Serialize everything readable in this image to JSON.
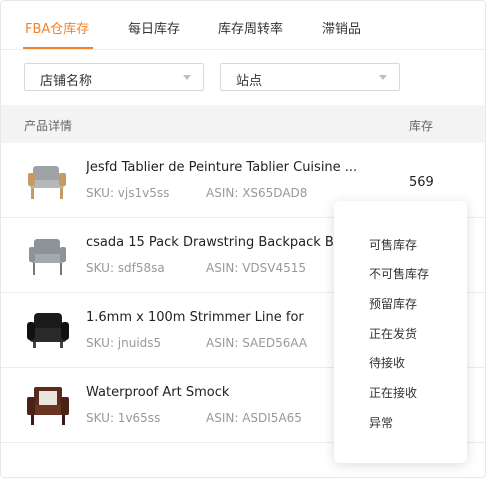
{
  "tabs": [
    {
      "label": "FBA仓库存"
    },
    {
      "label": "每日库存"
    },
    {
      "label": "库存周转率"
    },
    {
      "label": "滞销品"
    }
  ],
  "filters": {
    "shop_select": "店铺名称",
    "site_select": "站点"
  },
  "table": {
    "header_product": "产品详情",
    "header_stock": "库存"
  },
  "rows": [
    {
      "title": "Jesfd Tablier de Peinture Tablier Cuisine ...",
      "sku": "SKU: vjs1v5ss",
      "asin": "ASIN: XS65DAD8",
      "qty": "569",
      "thumb_icon": "gray-armchair-icon"
    },
    {
      "title": "csada 15 Pack Drawstring Backpack Ba",
      "sku": "SKU: sdf58sa",
      "asin": "ASIN: VDSV4515",
      "qty": "",
      "thumb_icon": "gray-armchair-icon"
    },
    {
      "title": "1.6mm x 100m Strimmer Line for",
      "sku": "SKU: jnuids5",
      "asin": "ASIN: SAED56AA",
      "qty": "",
      "thumb_icon": "black-sofa-chair-icon"
    },
    {
      "title": "Waterproof Art Smock",
      "sku": "SKU: 1v65ss",
      "asin": "ASIN: ASDI5A65",
      "qty": "",
      "thumb_icon": "brown-leather-chair-icon"
    }
  ],
  "dropdown": {
    "items": [
      "可售库存",
      "不可售库存",
      "预留库存",
      "正在发货",
      "待接收",
      "正在接收",
      "异常"
    ]
  },
  "colors": {
    "accent": "#f5812b",
    "text": "#333333",
    "muted": "#999999",
    "header_bg": "#f4f4f4"
  }
}
